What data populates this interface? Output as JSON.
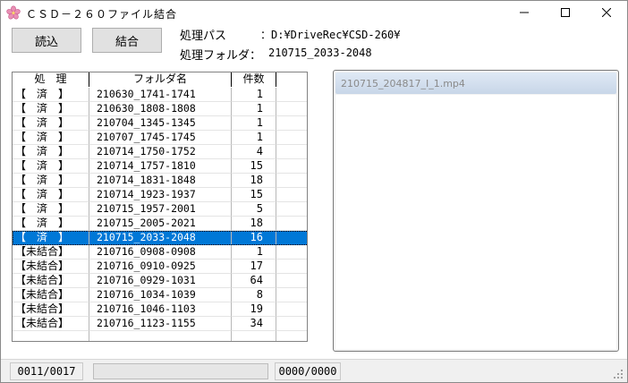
{
  "window": {
    "title": "ＣＳＤ－２６０ファイル結合",
    "icon": "sakura-flower-icon",
    "controls": {
      "minimize": "minimize-icon",
      "maximize": "maximize-icon",
      "close": "close-icon"
    }
  },
  "toolbar": {
    "load_label": "読込",
    "merge_label": "結合"
  },
  "info": {
    "path_label": "処理パス",
    "path_value": "：D:¥DriveRec¥CSD-260¥",
    "folder_label": "処理フォルダ：",
    "folder_value": "210715_2033-2048"
  },
  "grid": {
    "columns": [
      "処　理",
      "フォルダ名",
      "件数",
      ""
    ],
    "rows": [
      {
        "status": "【　済　】",
        "folder": "210630_1741-1741",
        "count": "1"
      },
      {
        "status": "【　済　】",
        "folder": "210630_1808-1808",
        "count": "1"
      },
      {
        "status": "【　済　】",
        "folder": "210704_1345-1345",
        "count": "1"
      },
      {
        "status": "【　済　】",
        "folder": "210707_1745-1745",
        "count": "1"
      },
      {
        "status": "【　済　】",
        "folder": "210714_1750-1752",
        "count": "4"
      },
      {
        "status": "【　済　】",
        "folder": "210714_1757-1810",
        "count": "15"
      },
      {
        "status": "【　済　】",
        "folder": "210714_1831-1848",
        "count": "18"
      },
      {
        "status": "【　済　】",
        "folder": "210714_1923-1937",
        "count": "15"
      },
      {
        "status": "【　済　】",
        "folder": "210715_1957-2001",
        "count": "5"
      },
      {
        "status": "【　済　】",
        "folder": "210715_2005-2021",
        "count": "18"
      },
      {
        "status": "【　済　】",
        "folder": "210715_2033-2048",
        "count": "16",
        "selected": true
      },
      {
        "status": "【未結合】",
        "folder": "210716_0908-0908",
        "count": "1"
      },
      {
        "status": "【未結合】",
        "folder": "210716_0910-0925",
        "count": "17"
      },
      {
        "status": "【未結合】",
        "folder": "210716_0929-1031",
        "count": "64"
      },
      {
        "status": "【未結合】",
        "folder": "210716_1034-1039",
        "count": "8"
      },
      {
        "status": "【未結合】",
        "folder": "210716_1046-1103",
        "count": "19"
      },
      {
        "status": "【未結合】",
        "folder": "210716_1123-1155",
        "count": "34"
      },
      {
        "status": "",
        "folder": "",
        "count": ""
      }
    ],
    "selection_color": "#0078d7"
  },
  "preview": {
    "title": "210715_204817_I_1.mp4"
  },
  "status": {
    "count": "0011/0017",
    "progress": 0,
    "frames": "0000/0000",
    "progress_color": "#06b025"
  }
}
